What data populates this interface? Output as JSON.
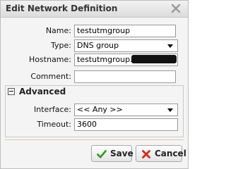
{
  "dialog": {
    "title": "Edit Network Definition",
    "close_icon": "close-icon"
  },
  "form": {
    "name_label": "Name:",
    "name_value": "testutmgroup",
    "type_label": "Type:",
    "type_value": "DNS group",
    "hostname_label": "Hostname:",
    "hostname_value": "testutmgroup.",
    "hostname_redacted": true,
    "comment_label": "Comment:",
    "comment_value": ""
  },
  "advanced": {
    "label": "Advanced",
    "interface_label": "Interface:",
    "interface_value": "<< Any >>",
    "timeout_label": "Timeout:",
    "timeout_value": "3600"
  },
  "buttons": {
    "save_label": "Save",
    "cancel_label": "Cancel"
  },
  "colors": {
    "save_icon": "#3a9b2e",
    "cancel_icon": "#d42a1a"
  }
}
